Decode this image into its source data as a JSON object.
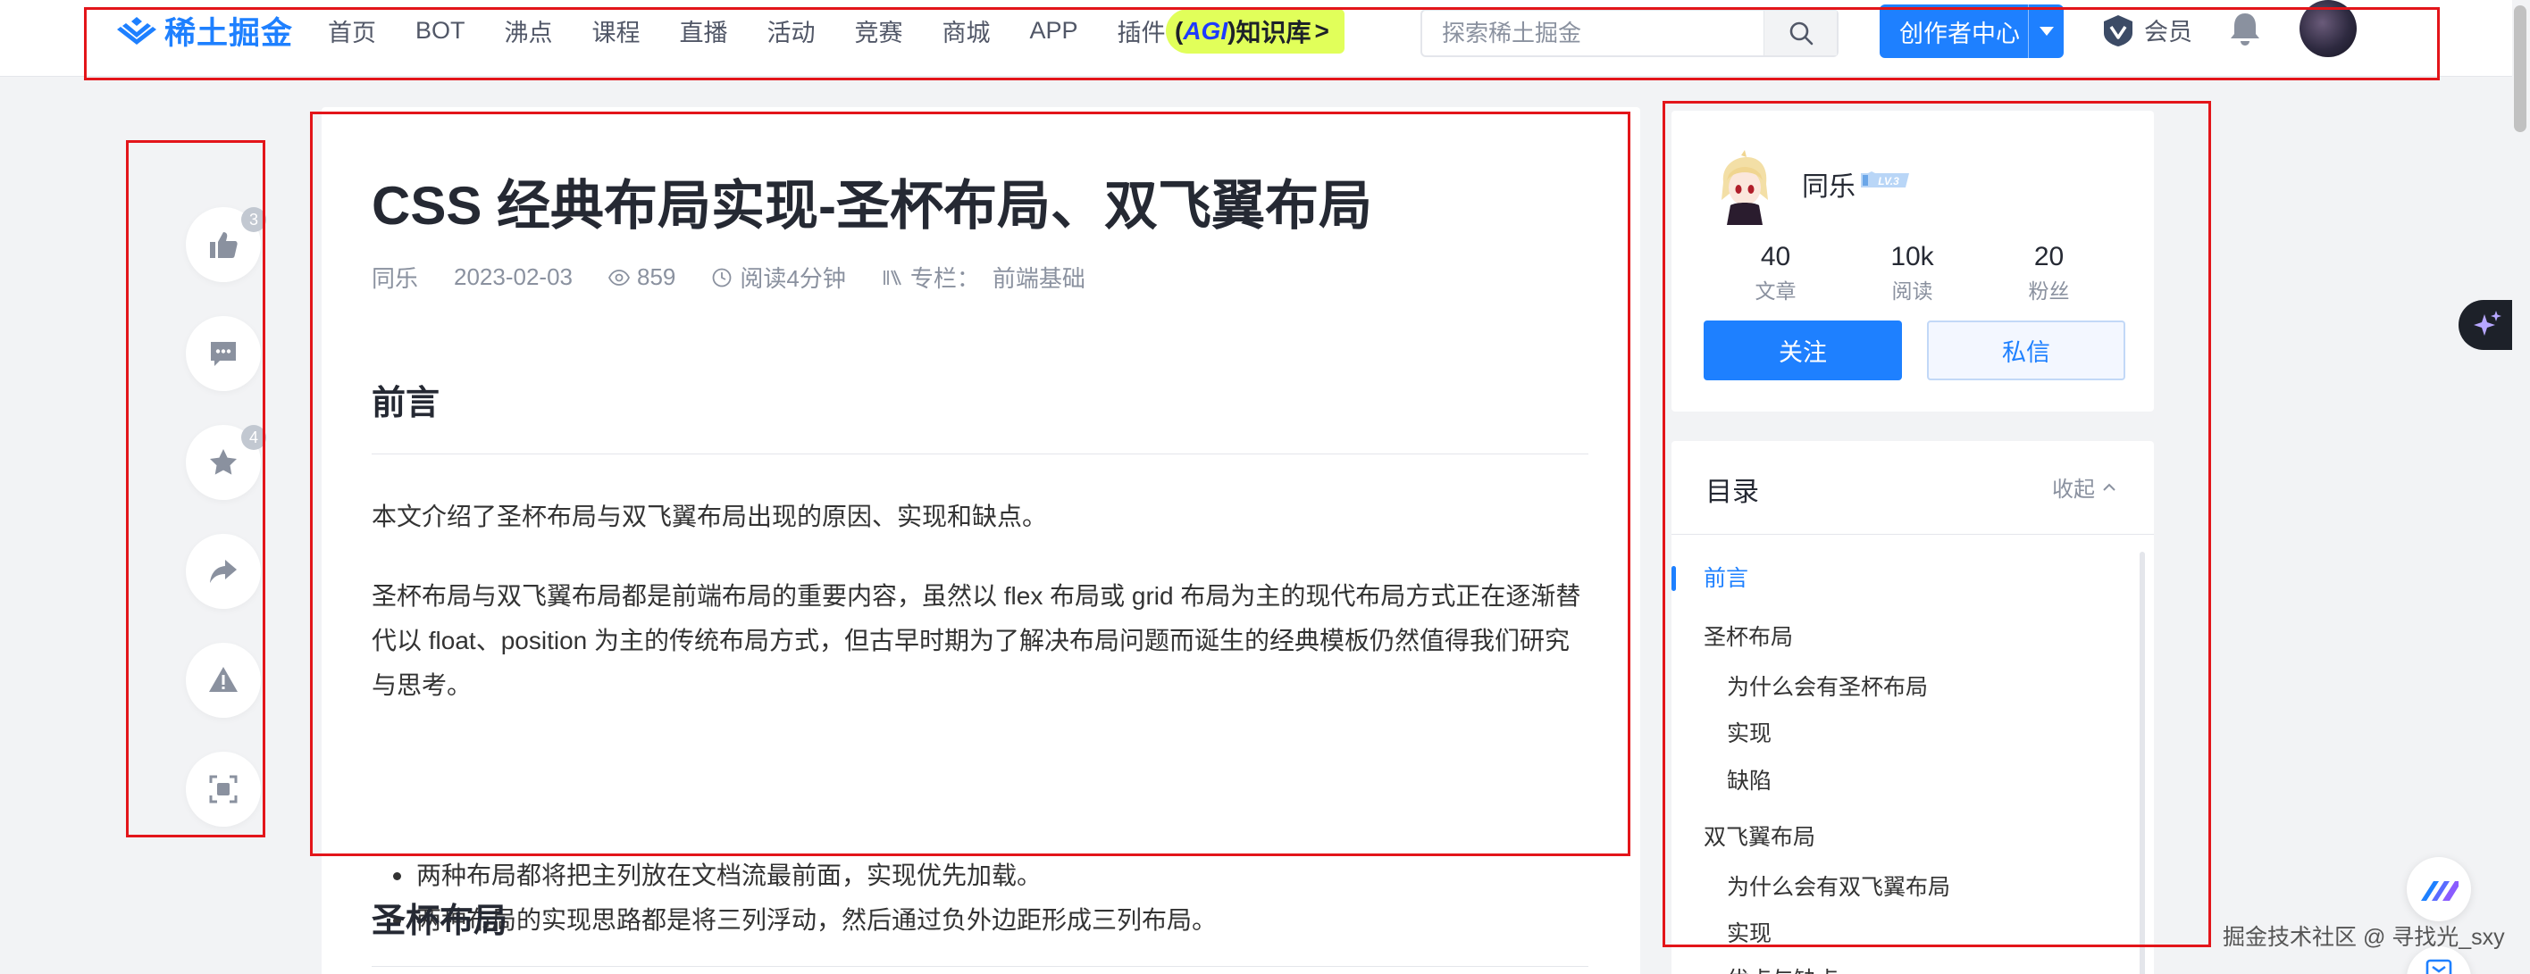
{
  "header": {
    "logo_text": "稀土掘金",
    "nav": [
      "首页",
      "BOT",
      "沸点",
      "课程",
      "直播",
      "活动",
      "竞赛",
      "商城",
      "APP",
      "插件"
    ],
    "agi_badge": {
      "open": "(",
      "agi": "AGI",
      "close": ")",
      "label": "知识库",
      "arrow": ">"
    },
    "search_placeholder": "探索稀土掘金",
    "creator_button": "创作者中心",
    "vip_label": "会员"
  },
  "actions": {
    "like_count": "3",
    "collect_count": "4",
    "items": [
      "like",
      "comment",
      "collect",
      "share",
      "report",
      "fullscreen"
    ]
  },
  "article": {
    "title": "CSS 经典布局实现-圣杯布局、双飞翼布局",
    "author": "同乐",
    "date": "2023-02-03",
    "views": "859",
    "read_time": "阅读4分钟",
    "column_label": "专栏：",
    "column_name": "前端基础",
    "section1_heading": "前言",
    "intro": "本文介绍了圣杯布局与双飞翼布局出现的原因、实现和缺点。",
    "paragraph": "圣杯布局与双飞翼布局都是前端布局的重要内容，虽然以 flex 布局或 grid 布局为主的现代布局方式正在逐渐替代以 float、position 为主的传统布局方式，但古早时期为了解决布局问题而诞生的经典模板仍然值得我们研究与思考。",
    "bullets": [
      "两种布局都将把主列放在文档流最前面，实现优先加载。",
      "两种布局的实现思路都是将三列浮动，然后通过负外边距形成三列布局。"
    ],
    "section2_heading": "圣杯布局"
  },
  "author_card": {
    "name": "同乐",
    "level": "LV.3",
    "stats": [
      {
        "value": "40",
        "label": "文章"
      },
      {
        "value": "10k",
        "label": "阅读"
      },
      {
        "value": "20",
        "label": "粉丝"
      }
    ],
    "follow": "关注",
    "message": "私信"
  },
  "toc": {
    "title": "目录",
    "collapse": "收起",
    "items": [
      {
        "text": "前言",
        "level": 1,
        "active": true
      },
      {
        "text": "圣杯布局",
        "level": 1,
        "active": false
      },
      {
        "text": "为什么会有圣杯布局",
        "level": 2,
        "active": false
      },
      {
        "text": "实现",
        "level": 2,
        "active": false
      },
      {
        "text": "缺陷",
        "level": 2,
        "active": false
      },
      {
        "text": "双飞翼布局",
        "level": 1,
        "active": false
      },
      {
        "text": "为什么会有双飞翼布局",
        "level": 2,
        "active": false
      },
      {
        "text": "实现",
        "level": 2,
        "active": false
      },
      {
        "text": "优点与缺点",
        "level": 2,
        "active": false
      }
    ]
  },
  "watermark": "掘金技术社区 @ 寻找光_sxy",
  "colors": {
    "brand": "#1e80ff",
    "annotation": "#e3151a",
    "agi_badge": "#e1ff5a"
  }
}
